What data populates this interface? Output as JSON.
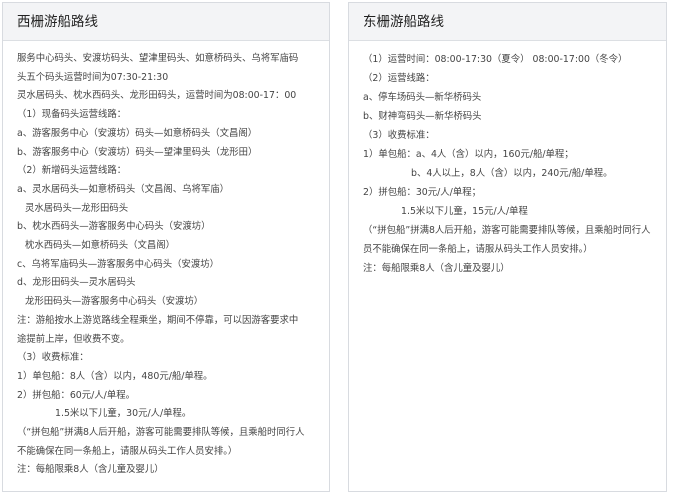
{
  "left_panel": {
    "title": "西栅游船路线",
    "lines": [
      {
        "text": "服务中心码头、安渡坊码头、望津里码头、如意桥码头、乌将军庙码",
        "indent": 0
      },
      {
        "text": "头五个码头运营时间为07:30-21:30",
        "indent": 0
      },
      {
        "text": "灵水居码头、枕水西码头、龙形田码头，运营时间为08:00-17：00",
        "indent": 0
      },
      {
        "text": "（1）现备码头运营线路：",
        "indent": 0
      },
      {
        "text": "a、游客服务中心（安渡坊）码头—如意桥码头（文昌阁）",
        "indent": 0
      },
      {
        "text": "b、游客服务中心（安渡坊）码头—望津里码头（龙形田）",
        "indent": 0
      },
      {
        "text": "（2）新增码头运营线路：",
        "indent": 0
      },
      {
        "text": "a、灵水居码头—如意桥码头（文昌阁、乌将军庙）",
        "indent": 0
      },
      {
        "text": "灵水居码头—龙形田码头",
        "indent": 8
      },
      {
        "text": "b、枕水西码头—游客服务中心码头（安渡坊）",
        "indent": 0
      },
      {
        "text": "枕水西码头—如意桥码头（文昌阁）",
        "indent": 8
      },
      {
        "text": "c、乌将军庙码头—游客服务中心码头（安渡坊）",
        "indent": 0
      },
      {
        "text": "d、龙形田码头—灵水居码头",
        "indent": 0
      },
      {
        "text": "龙形田码头—游客服务中心码头（安渡坊）",
        "indent": 8
      },
      {
        "text": "注：游船按水上游览路线全程乘坐，期间不停靠，可以因游客要求中",
        "indent": 0
      },
      {
        "text": "途提前上岸，但收费不变。",
        "indent": 0
      },
      {
        "text": "（3）收费标准：",
        "indent": 0
      },
      {
        "text": "1）单包船：8人（含）以内，480元/船/单程。",
        "indent": 0
      },
      {
        "text": "2）拼包船：60元/人/单程。",
        "indent": 0
      },
      {
        "text": "1.5米以下儿童，30元/人/单程。",
        "indent": 38
      },
      {
        "text": "（“拼包船”拼满8人后开船，游客可能需要排队等候，且乘船时同行人",
        "indent": 0
      },
      {
        "text": "不能确保在同一条船上，请服从码头工作人员安排。）",
        "indent": 0
      },
      {
        "text": "注：每船限乘8人（含儿童及婴儿）",
        "indent": 0
      }
    ]
  },
  "right_panel": {
    "title": "东栅游船路线",
    "lines": [
      {
        "text": "（1）运营时间：08:00-17:30（夏令） 08:00-17:00（冬令）",
        "indent": 0
      },
      {
        "text": "（2）运营线路：",
        "indent": 0
      },
      {
        "text": "a、停车场码头—新华桥码头",
        "indent": 0
      },
      {
        "text": "b、财神弯码头—新华桥码头",
        "indent": 0
      },
      {
        "text": "（3）收费标准：",
        "indent": 0
      },
      {
        "text": "1）单包船：a、4人（含）以内，160元/船/单程；",
        "indent": 0
      },
      {
        "text": "b、4人以上，8人（含）以内，240元/船/单程。",
        "indent": 48
      },
      {
        "text": "2）拼包船：30元/人/单程；",
        "indent": 0
      },
      {
        "text": "1.5米以下儿童，15元/人/单程",
        "indent": 38
      },
      {
        "text": "（“拼包船”拼满8人后开船，游客可能需要排队等候，且乘船时同行人",
        "indent": 0
      },
      {
        "text": "员不能确保在同一条船上，请服从码头工作人员安排。）",
        "indent": 0
      },
      {
        "text": "注：每船限乘8人（含儿童及婴儿）",
        "indent": 0
      }
    ]
  }
}
